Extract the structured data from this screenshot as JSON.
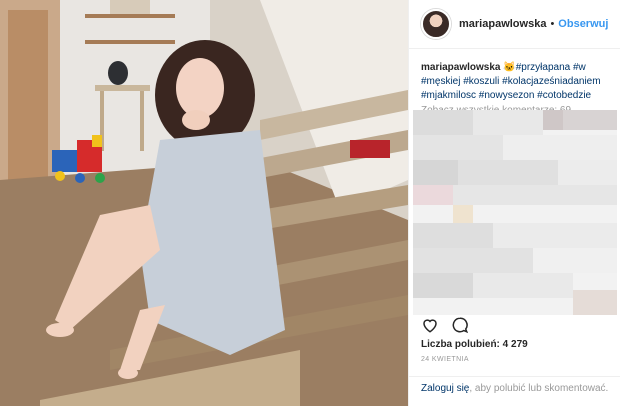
{
  "author": {
    "username": "mariapawlowska",
    "follow_label": "Obserwuj",
    "separator": "•"
  },
  "caption": {
    "username": "mariapawlowska",
    "emoji": "🐱",
    "hashtags": [
      "#przyłapana",
      "#w",
      "#męskiej",
      "#koszuli",
      "#kolacjaześniadaniem",
      "#mjakmilosc",
      "#nowysezon",
      "#cotobedzie"
    ]
  },
  "comments": {
    "view_all_label": "Zobacz wszystkie komentarze: 69"
  },
  "stats": {
    "likes_label": "Liczba polubień: 4 279",
    "date_label": "24 KWIETNIA"
  },
  "footer": {
    "login_link": "Zaloguj się",
    "login_rest": ", aby polubić lub skomentować."
  },
  "icons": {
    "like": "heart-outline-icon",
    "comment": "comment-bubble-icon",
    "avatar": "profile-avatar"
  },
  "colors": {
    "follow_blue": "#3897f0",
    "hashtag_blue": "#003569",
    "muted_gray": "#999999"
  }
}
